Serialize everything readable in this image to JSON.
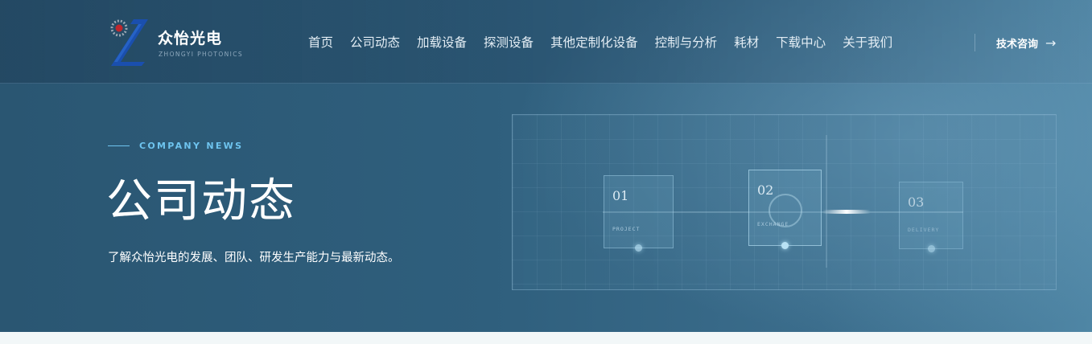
{
  "header": {
    "brand_name": "众怡光电",
    "brand_sub": "ZHONGYI PHOTONICS",
    "nav": [
      {
        "label": "首页"
      },
      {
        "label": "公司动态"
      },
      {
        "label": "加载设备"
      },
      {
        "label": "探测设备"
      },
      {
        "label": "其他定制化设备"
      },
      {
        "label": "控制与分析"
      },
      {
        "label": "耗材"
      },
      {
        "label": "下载中心"
      },
      {
        "label": "关于我们"
      }
    ],
    "consult_label": "技术咨询",
    "consult_arrow": "→"
  },
  "hero": {
    "eyebrow": "COMPANY NEWS",
    "title": "公司动态",
    "description": "了解众怡光电的发展、团队、研发生产能力与最新动态。"
  },
  "illustration": {
    "steps": [
      {
        "num": "01",
        "label": "PROJECT"
      },
      {
        "num": "02",
        "label": "EXCHANGE"
      },
      {
        "num": "03",
        "label": "DELIVERY"
      }
    ]
  },
  "colors": {
    "accent": "#6ec4ef",
    "logo_blue": "#1a4fae",
    "logo_red": "#c0272d"
  }
}
